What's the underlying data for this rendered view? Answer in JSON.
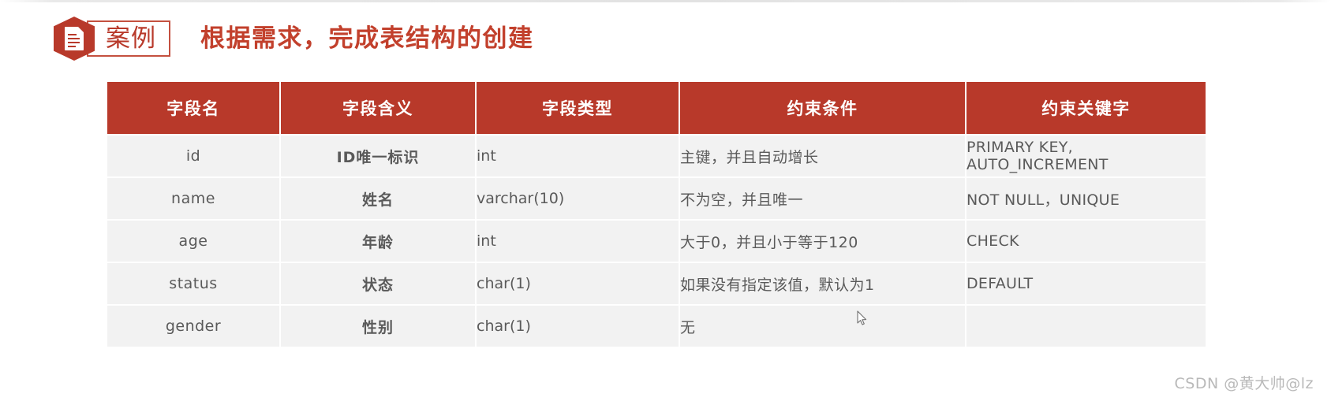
{
  "slide": {
    "badge_label": "案例",
    "title": "根据需求，完成表结构的创建",
    "badge_icon": "document-icon",
    "accent_color": "#b8392a",
    "title_color": "#c2402c",
    "keyword_color": "#e8503a",
    "row_background": "#f2f2f2"
  },
  "table": {
    "headers": [
      "字段名",
      "字段含义",
      "字段类型",
      "约束条件",
      "约束关键字"
    ],
    "rows": [
      {
        "field": "id",
        "meaning": "ID唯一标识",
        "type": "int",
        "constraint": "主键，并且自动增长",
        "keyword": "PRIMARY KEY, AUTO_INCREMENT"
      },
      {
        "field": "name",
        "meaning": "姓名",
        "type": "varchar(10)",
        "constraint": "不为空，并且唯一",
        "keyword": "NOT NULL，UNIQUE"
      },
      {
        "field": "age",
        "meaning": "年龄",
        "type": "int",
        "constraint": "大于0，并且小于等于120",
        "keyword": "CHECK"
      },
      {
        "field": "status",
        "meaning": "状态",
        "type": "char(1)",
        "constraint": "如果没有指定该值，默认为1",
        "keyword": "DEFAULT"
      },
      {
        "field": "gender",
        "meaning": "性别",
        "type": "char(1)",
        "constraint": "无",
        "keyword": ""
      }
    ]
  },
  "watermark": "CSDN @黄大帅@lz"
}
